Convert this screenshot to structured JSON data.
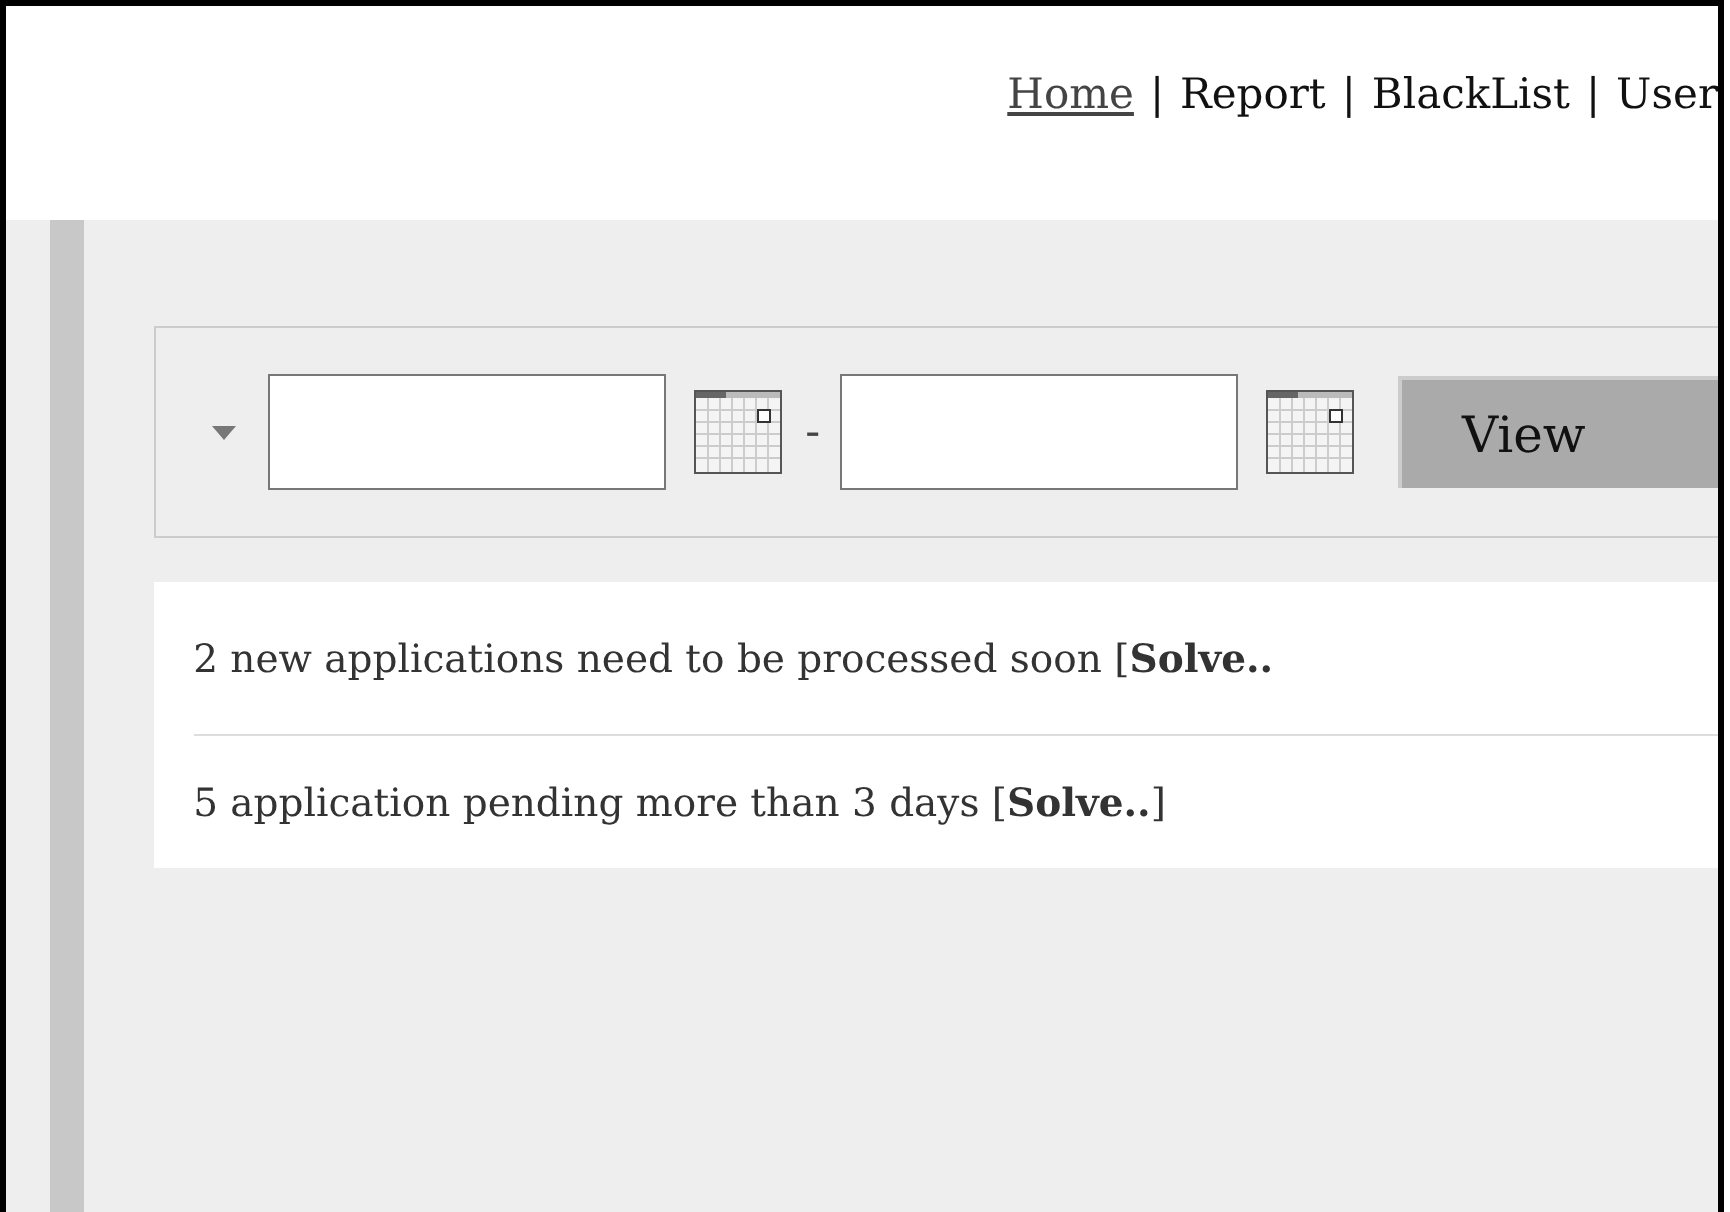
{
  "nav": [
    {
      "kind": "link",
      "label": "Home",
      "selected": true
    },
    {
      "kind": "separator",
      "label": "|"
    },
    {
      "kind": "link",
      "label": "Report",
      "selected": false
    },
    {
      "kind": "separator",
      "label": "|"
    },
    {
      "kind": "link",
      "label": "BlackList",
      "selected": false
    },
    {
      "kind": "separator",
      "label": "|"
    },
    {
      "kind": "link",
      "label": "User",
      "selected": false
    }
  ],
  "filter": {
    "separator": "-",
    "button": "View"
  },
  "notices": [
    {
      "text": "2 new applications need to be processed soon [**Solve..**"
    },
    {
      "text": "5 application pending more than 3 days [**Solve..**]"
    }
  ]
}
